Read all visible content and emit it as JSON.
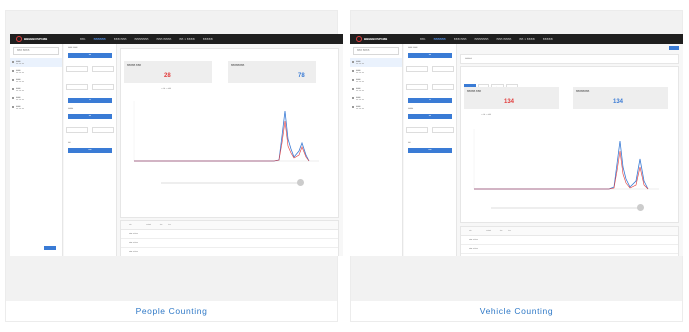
{
  "cards": [
    {
      "caption": "People Counting",
      "app": {
        "brand": "BBBBBUSP1MB",
        "menu": [
          "BB1",
          "BBBBBB",
          "BBB BBB",
          "BBBBBBB",
          "BBB BBBB",
          "BB 1 BBBB",
          "BBBBB"
        ],
        "search_placeholder": "BBB BBBB",
        "stat1_label": "BBBBB BBB",
        "stat1_value": "28",
        "stat2_label": "BBBBBBBB",
        "stat2_value": "78"
      }
    },
    {
      "caption": "Vehicle Counting",
      "app": {
        "brand": "BBBBBUSP1MB",
        "menu": [
          "BB1",
          "BBBBBB",
          "BBB BBB",
          "BBBBBBB",
          "BBB BBBB",
          "BB 1 BBBB",
          "BBBBB"
        ],
        "search_placeholder": "BBB BBBB",
        "stat1_label": "BBBBB BBB",
        "stat1_value": "134",
        "stat2_label": "BBBBBBBB",
        "stat2_value": "134"
      }
    }
  ],
  "colors": {
    "accent": "#3a7bd5",
    "caption": "#2f79c7",
    "topbar": "#1f1f1f",
    "red_value": "#e23b3b",
    "blue_value": "#3a7bd5"
  }
}
